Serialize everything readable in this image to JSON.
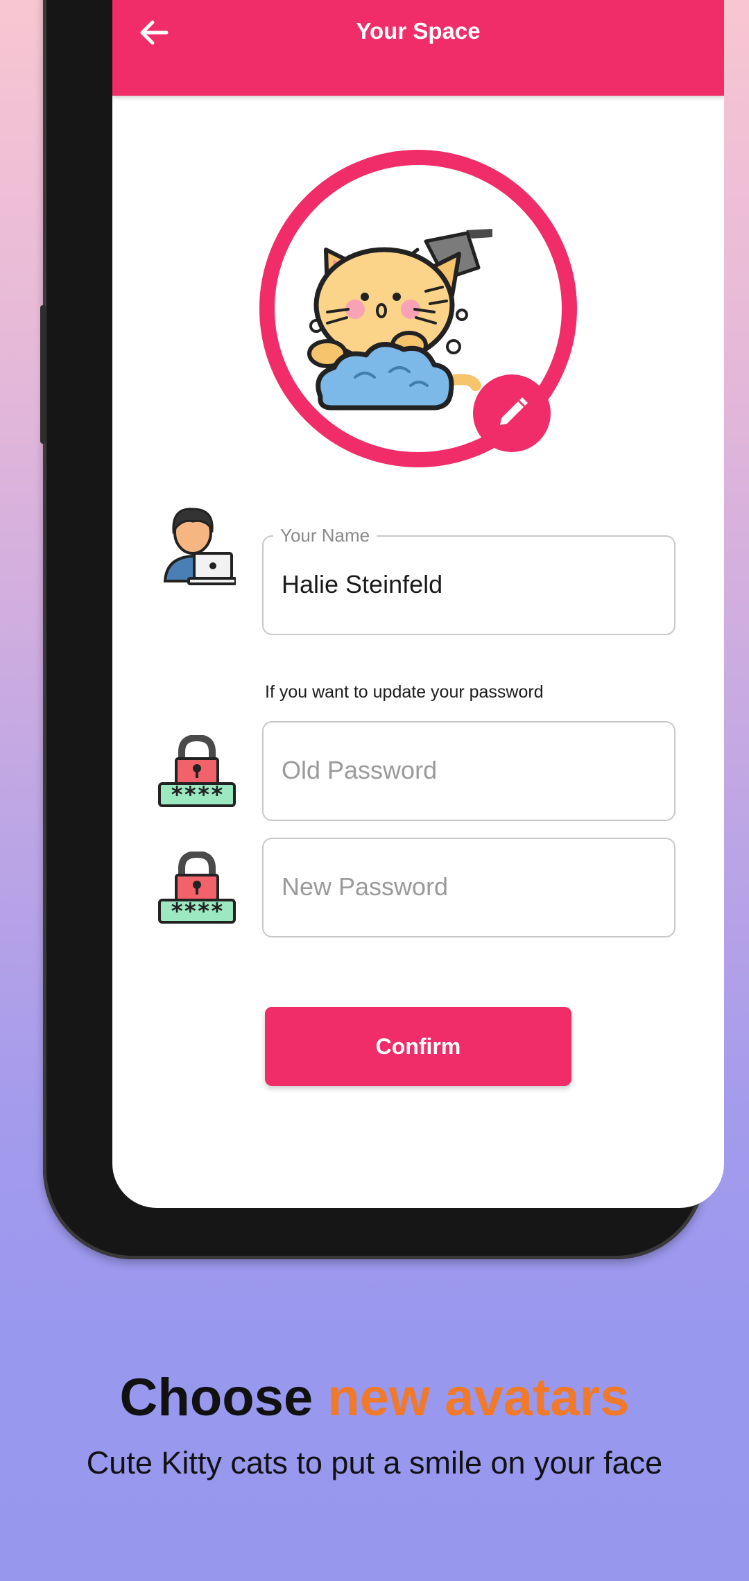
{
  "appbar": {
    "title": "Your Space"
  },
  "avatar": {
    "description_icon": "kitty-shower-avatar"
  },
  "form": {
    "name_label": "Your Name",
    "name_value": "Halie Steinfeld",
    "password_hint": "If you want to update your password",
    "old_password_placeholder": "Old Password",
    "new_password_placeholder": "New Password",
    "confirm_label": "Confirm"
  },
  "promo": {
    "headline_part1": "Choose ",
    "headline_part2": "new avatars",
    "subline": "Cute Kitty cats to put a smile on your face"
  },
  "colors": {
    "primary": "#f02d68",
    "accent": "#f07a2a"
  }
}
